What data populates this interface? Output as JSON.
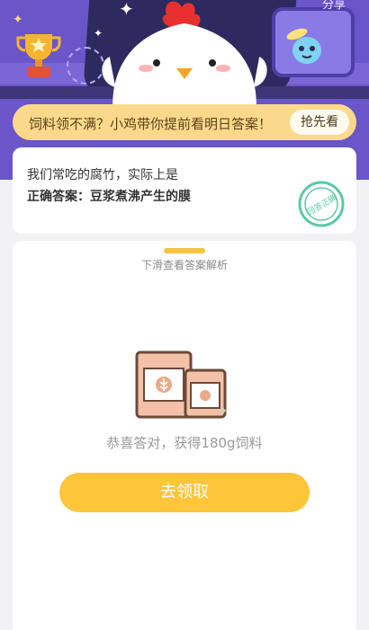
{
  "header": {
    "corner_label": "分享"
  },
  "banner": {
    "text": "饲料领不满？小鸡带你提前看明日答案！",
    "button_label": "抢先看"
  },
  "question_card": {
    "question": "我们常吃的腐竹，实际上是",
    "answer_prefix": "正确答案：",
    "answer": "豆浆煮沸产生的膜",
    "stamp_text": "回答正确"
  },
  "result_card": {
    "hint": "下滑查看答案解析",
    "result_text": "恭喜答对，获得180g饲料",
    "claim_button": "去领取"
  },
  "colors": {
    "banner_bg": "#fbd98c",
    "button_bg": "#fcc53a",
    "stamp_green": "#5cc9a2",
    "header_purple": "#6a55c9"
  },
  "icons": [
    "trophy-icon",
    "chicken-mascot",
    "alien-mascot",
    "correct-stamp-icon",
    "feed-bag-icon"
  ]
}
